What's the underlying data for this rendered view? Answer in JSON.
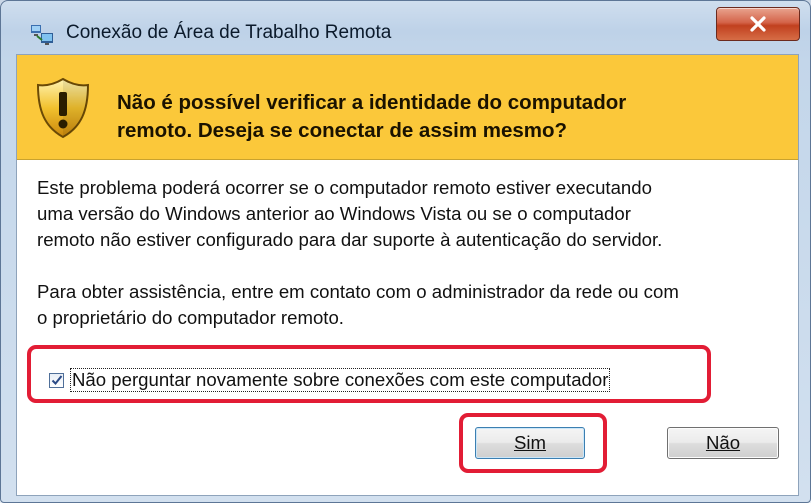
{
  "window": {
    "title": "Conexão de Área de Trabalho Remota",
    "close_icon": "close-icon"
  },
  "warning": {
    "icon": "shield-warning-icon",
    "line1": "Não é possível verificar a identidade do computador",
    "line2": "remoto. Deseja se conectar de assim mesmo?",
    "background": "#fbc83a"
  },
  "body": {
    "paragraph1": {
      "line1": "Este problema poderá ocorrer se o computador remoto estiver executando",
      "line2": "uma versão do Windows anterior ao Windows Vista ou se o computador",
      "line3": "remoto não estiver configurado para dar suporte à autenticação do servidor."
    },
    "paragraph2": {
      "line1": "Para obter assistência, entre em contato com o administrador da rede ou com",
      "line2": "o proprietário do computador remoto."
    }
  },
  "checkbox": {
    "checked": true,
    "label": "Não perguntar novamente sobre conexões com este computador"
  },
  "buttons": {
    "yes_label": "Sim",
    "no_label": "Não"
  },
  "colors": {
    "highlight": "#e21d35",
    "close_button": "#c1401f"
  }
}
